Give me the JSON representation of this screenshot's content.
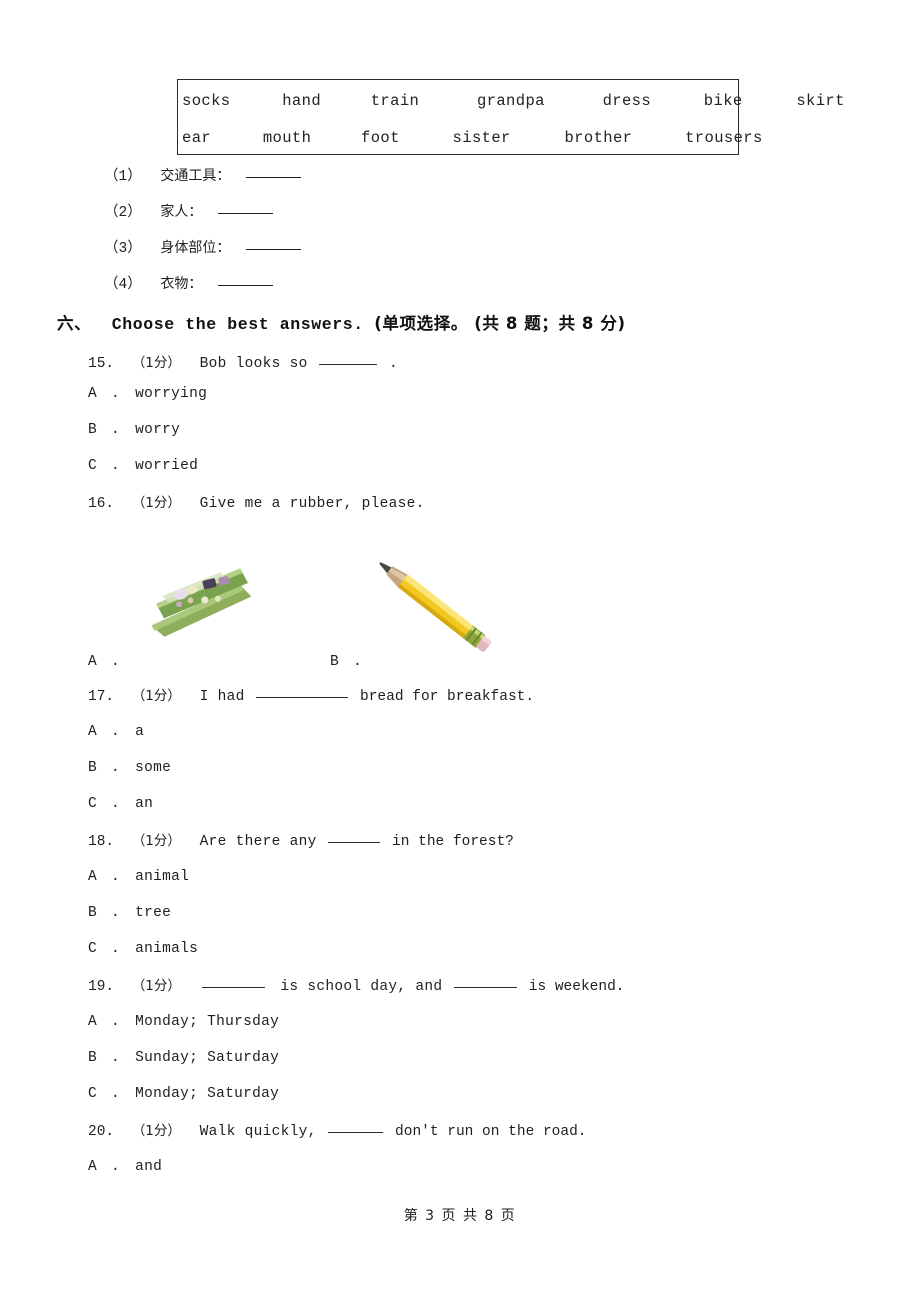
{
  "page": {
    "footer_text": "第 3 页 共 8 页",
    "page_number": "3",
    "total_pages": "8",
    "background_color": "#ffffff",
    "text_color": "#1f1f1f"
  },
  "word_bank": {
    "row1": [
      "socks",
      "hand",
      "train",
      "grandpa",
      "dress",
      "bike",
      "skirt"
    ],
    "row2": [
      "ear",
      "mouth",
      "foot",
      "sister",
      "brother",
      "trousers"
    ]
  },
  "categorize_items": [
    {
      "index": "（1）",
      "label": "交通工具："
    },
    {
      "index": "（2）",
      "label": "家人："
    },
    {
      "index": "（3）",
      "label": "身体部位："
    },
    {
      "index": "（4）",
      "label": "衣物："
    }
  ],
  "section": {
    "number": "六、",
    "title_en": "Choose the best answers.",
    "title_cn": "(单项选择。 (共 8 题；共 8 分)"
  },
  "questions": [
    {
      "number": "15.",
      "marks": "（1分）",
      "stem_before": "Bob looks so",
      "stem_after": ".",
      "options": [
        {
          "letter": "A",
          "dot": ".",
          "text": "worrying"
        },
        {
          "letter": "B",
          "dot": ".",
          "text": "worry"
        },
        {
          "letter": "C",
          "dot": ".",
          "text": "worried"
        }
      ]
    },
    {
      "number": "16.",
      "marks": "（1分）",
      "stem_before": "Give me a rubber, please.",
      "stem_after": "",
      "options": [
        {
          "letter": "A",
          "dot": ".",
          "text": "",
          "image": "green-eraser-image"
        },
        {
          "letter": "B",
          "dot": ".",
          "text": "",
          "image": "yellow-pencil-image"
        }
      ]
    },
    {
      "number": "17.",
      "marks": "（1分）",
      "stem_before": "I had",
      "stem_after": "bread for breakfast.",
      "options": [
        {
          "letter": "A",
          "dot": ".",
          "text": "a"
        },
        {
          "letter": "B",
          "dot": ".",
          "text": "some"
        },
        {
          "letter": "C",
          "dot": ".",
          "text": "an"
        }
      ]
    },
    {
      "number": "18.",
      "marks": "（1分）",
      "stem_before": "Are there any",
      "stem_after": "in the forest?",
      "options": [
        {
          "letter": "A",
          "dot": ".",
          "text": "animal"
        },
        {
          "letter": "B",
          "dot": ".",
          "text": "tree"
        },
        {
          "letter": "C",
          "dot": ".",
          "text": "animals"
        }
      ]
    },
    {
      "number": "19.",
      "marks": "（1分）",
      "stem_mid": "is school day, and",
      "stem_after": "is weekend.",
      "options": [
        {
          "letter": "A",
          "dot": ".",
          "text": "Monday; Thursday"
        },
        {
          "letter": "B",
          "dot": ".",
          "text": "Sunday; Saturday"
        },
        {
          "letter": "C",
          "dot": ".",
          "text": "Monday; Saturday"
        }
      ]
    },
    {
      "number": "20.",
      "marks": "（1分）",
      "stem_before": "Walk quickly,",
      "stem_after": "don't run on the road.",
      "options": [
        {
          "letter": "A",
          "dot": ".",
          "text": "and"
        }
      ]
    }
  ],
  "colors": {
    "eraser_green": "#7ba352",
    "eraser_green_light": "#a8c97e",
    "pencil_yellow": "#f5d12b",
    "pencil_wood": "#b9a184",
    "pencil_ferrule": "#8aa23c",
    "pencil_tip": "#6e6b66",
    "box_border": "#2b2b2b"
  }
}
